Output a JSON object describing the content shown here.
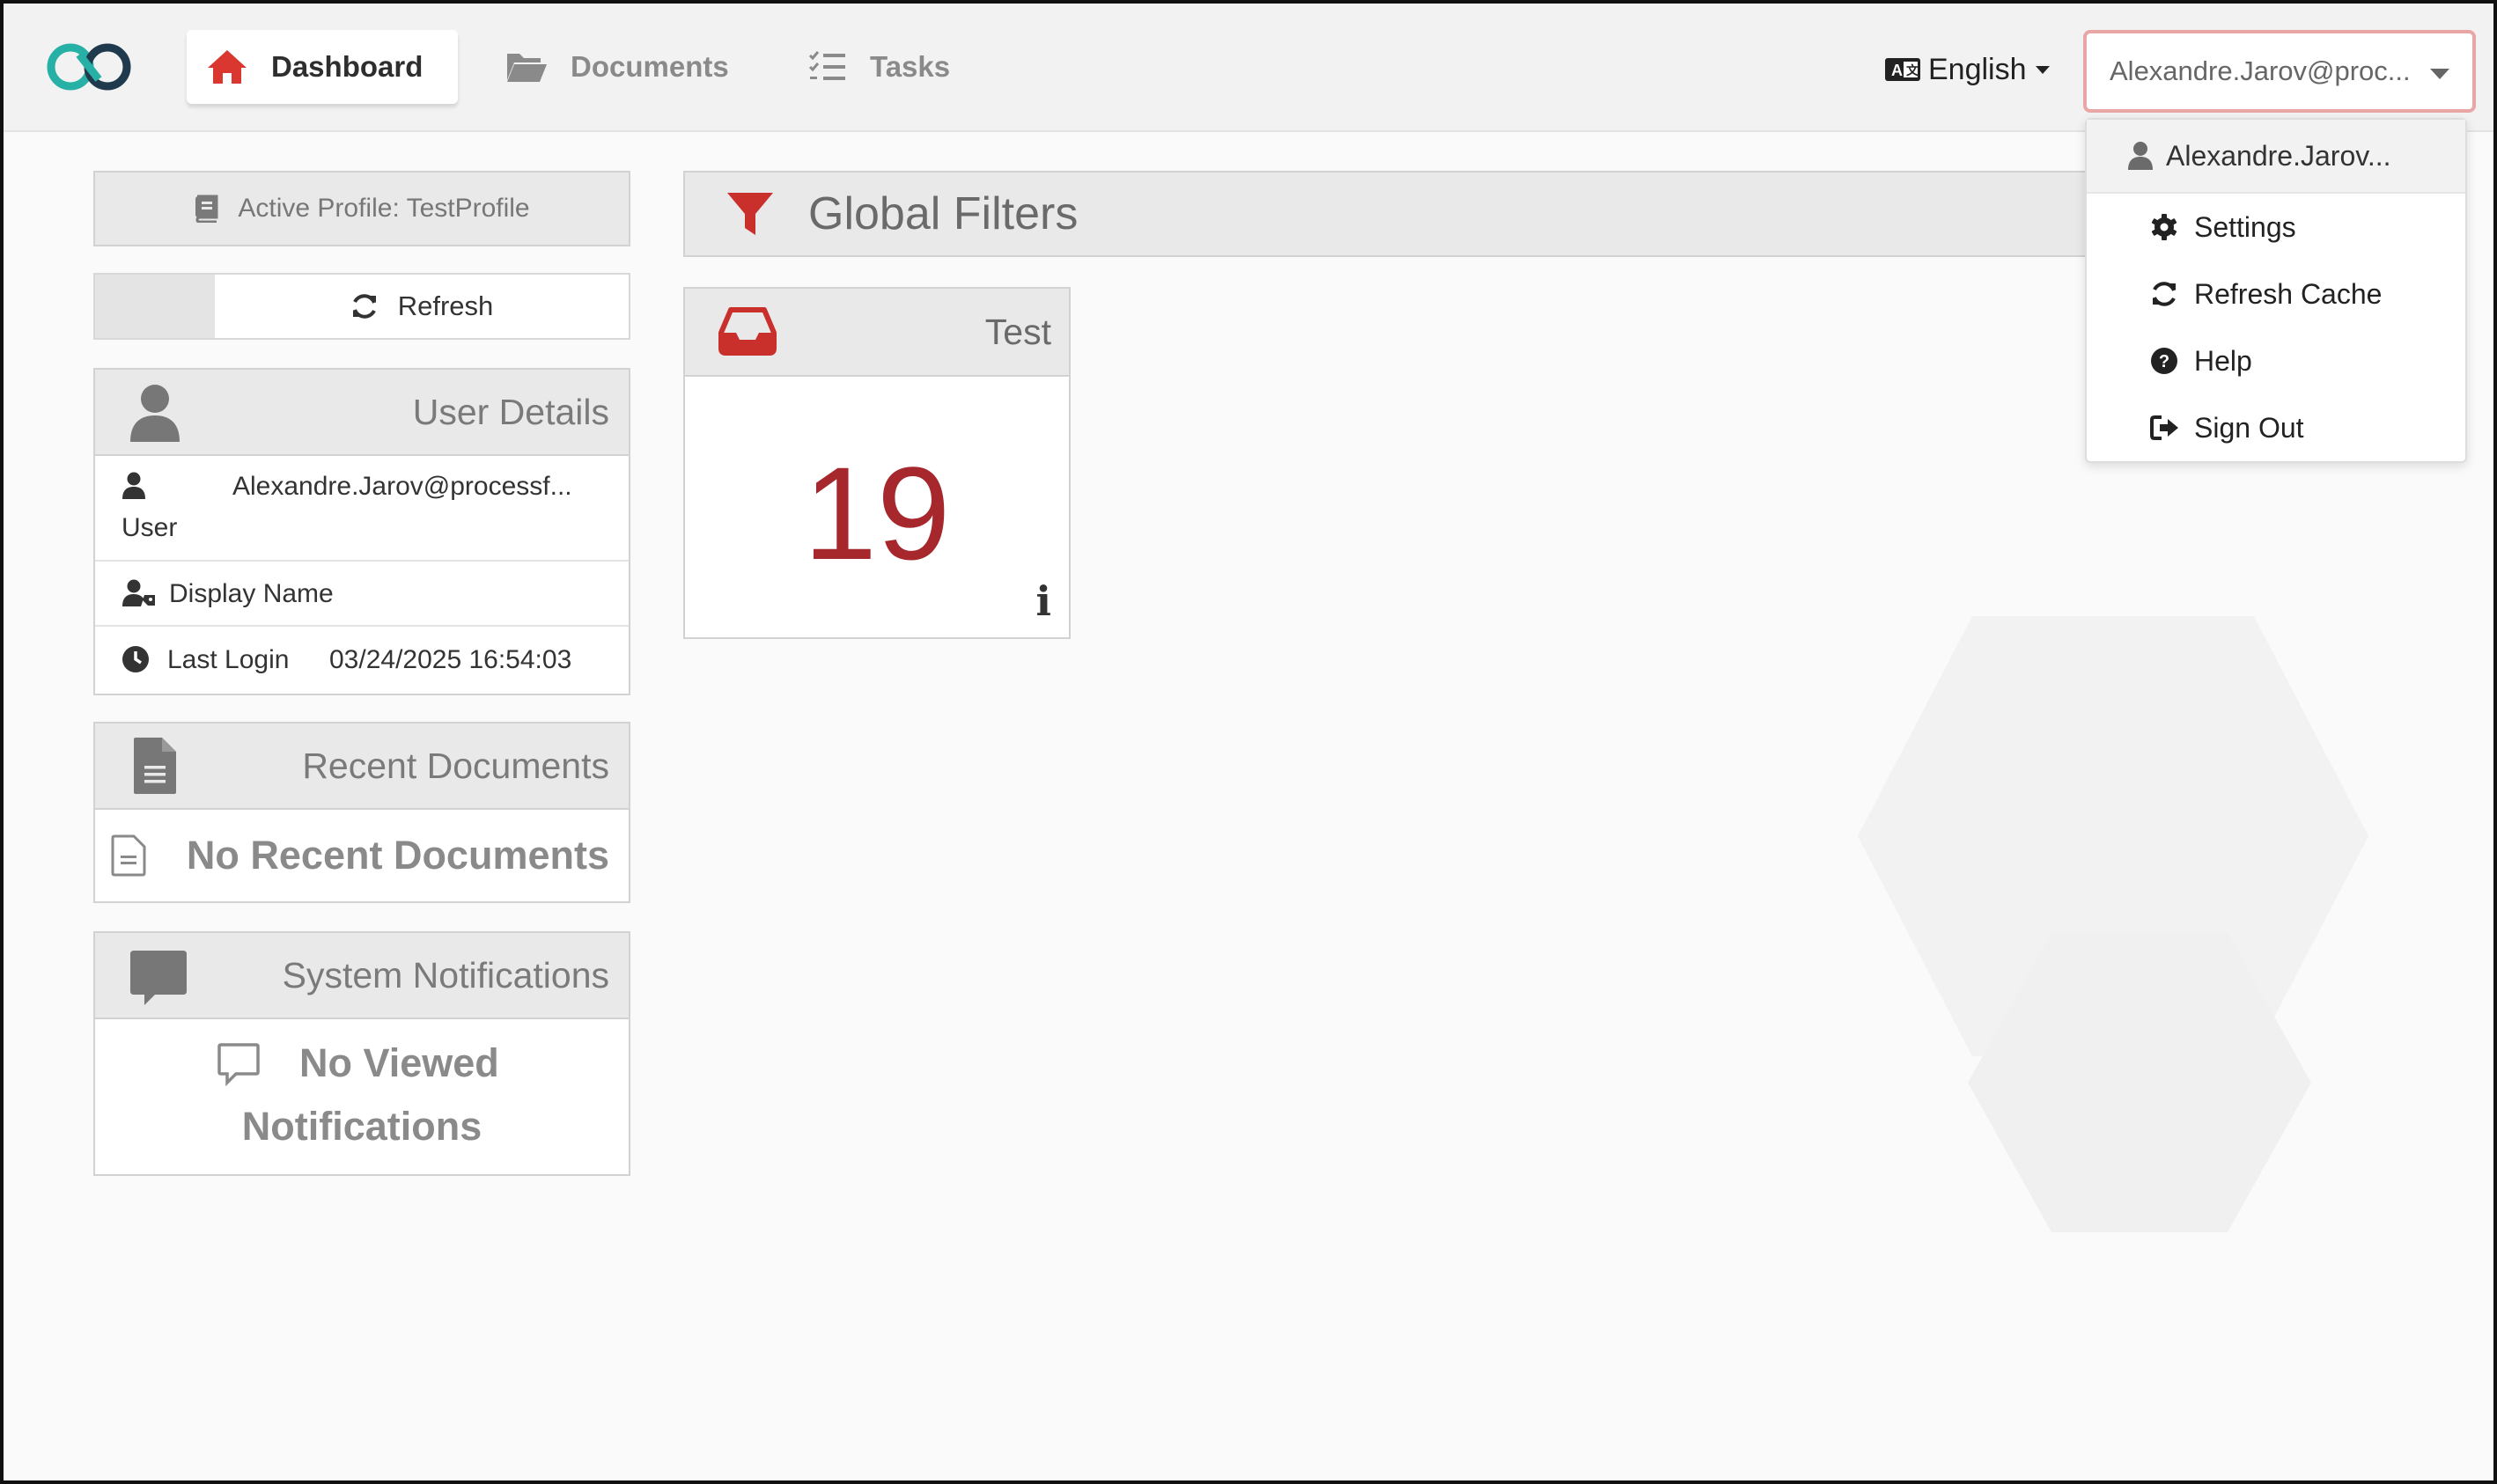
{
  "nav": {
    "tabs": [
      {
        "label": "Dashboard",
        "icon": "home-icon",
        "active": true
      },
      {
        "label": "Documents",
        "icon": "folder-open-icon",
        "active": false
      },
      {
        "label": "Tasks",
        "icon": "tasks-icon",
        "active": false
      }
    ],
    "language": {
      "label": "English",
      "icon": "language-icon"
    },
    "user_select": {
      "value": "Alexandre.Jarov@proc..."
    }
  },
  "user_menu": {
    "header": "Alexandre.Jarov...",
    "items": [
      {
        "label": "Settings",
        "icon": "gear-icon"
      },
      {
        "label": "Refresh Cache",
        "icon": "refresh-icon"
      },
      {
        "label": "Help",
        "icon": "question-circle-icon"
      },
      {
        "label": "Sign Out",
        "icon": "sign-out-icon"
      }
    ]
  },
  "sidebar": {
    "active_profile": "Active Profile: TestProfile",
    "refresh_label": "Refresh",
    "user_details": {
      "title": "User Details",
      "user_value": "Alexandre.Jarov@processf...",
      "user_label": "User",
      "display_name_label": "Display Name",
      "last_login_label": "Last Login",
      "last_login_value": "03/24/2025 16:54:03"
    },
    "recent_documents": {
      "title": "Recent Documents",
      "empty": "No Recent Documents"
    },
    "system_notifications": {
      "title": "System Notifications",
      "empty_line1": "No Viewed",
      "empty_line2": "Notifications"
    }
  },
  "main": {
    "filters_title": "Global Filters",
    "tile": {
      "title": "Test",
      "count": "19",
      "info": "i"
    }
  },
  "colors": {
    "accent_red": "#c9302c",
    "count_red": "#a6282c",
    "logo_teal": "#27b0a6",
    "logo_dark": "#1f3a4d"
  }
}
